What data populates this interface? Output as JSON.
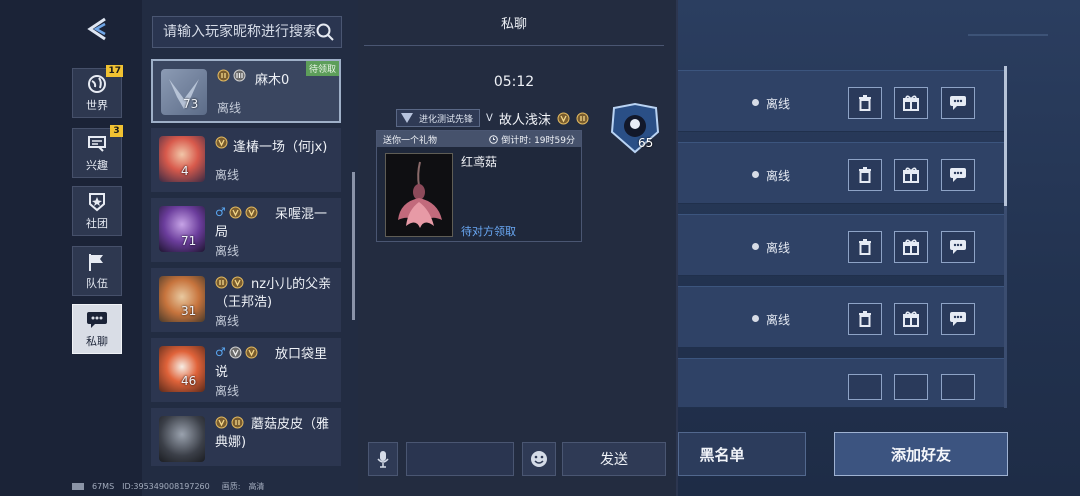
{
  "nav": {
    "items": [
      {
        "label": "世界",
        "badge": "17",
        "icon": "globe-icon"
      },
      {
        "label": "兴趣",
        "badge": "3",
        "icon": "interest-icon"
      },
      {
        "label": "社团",
        "badge": "",
        "icon": "club-shield-icon"
      },
      {
        "label": "队伍",
        "badge": "",
        "icon": "team-flag-icon"
      },
      {
        "label": "私聊",
        "badge": "",
        "icon": "chat-bubble-icon",
        "active": true
      }
    ]
  },
  "search": {
    "placeholder": "请输入玩家昵称进行搜索"
  },
  "friends": [
    {
      "name": "麻木0",
      "status": "离线",
      "level": "73",
      "tag": "待领取"
    },
    {
      "name": "逢椿一场（何jx)",
      "status": "离线",
      "level": "4"
    },
    {
      "name": "呆喔混一局",
      "status": "离线",
      "level": "71"
    },
    {
      "name": "nz小儿的父亲（王邦浩)",
      "status": "离线",
      "level": "31"
    },
    {
      "name": "放口袋里说",
      "status": "离线",
      "level": "46"
    },
    {
      "name": "蘑菇皮皮（雅典娜)",
      "status": "",
      "level": ""
    }
  ],
  "chat": {
    "title": "私聊",
    "time": "05:12",
    "sender_tag": "进化测试先锋",
    "sender_name": "故人浅沫",
    "sender_level": "65",
    "gift": {
      "header": "送你一个礼物",
      "countdown": "倒计时: 19时59分",
      "item_name": "红鸢菇",
      "action": "待对方领取"
    },
    "send_label": "发送",
    "input_value": ""
  },
  "right_list": {
    "rows": [
      {
        "status": "离线"
      },
      {
        "status": "离线"
      },
      {
        "status": "离线"
      },
      {
        "status": "离线"
      }
    ]
  },
  "buttons": {
    "blacklist": "黑名单",
    "add_friend": "添加好友"
  },
  "footer": {
    "ping": "67MS",
    "id": "ID:395349008197260",
    "quality_label": "画质:",
    "quality_value": "高清"
  },
  "colors": {
    "accent_blue": "#6aa9f5",
    "badge_yellow": "#f1c232",
    "tag_green": "#5d9e5a"
  }
}
